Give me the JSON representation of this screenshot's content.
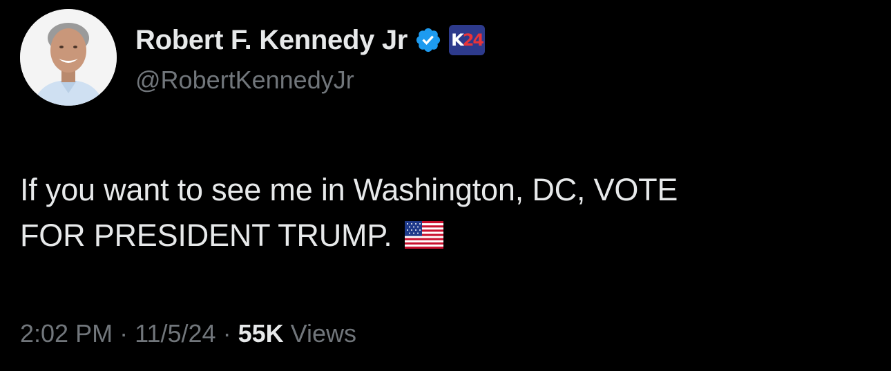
{
  "author": {
    "display_name": "Robert F. Kennedy Jr",
    "handle": "@RobertKennedyJr",
    "affiliate_badge": {
      "prefix": "K",
      "suffix": "24"
    }
  },
  "tweet": {
    "text_line1": "If you want to see me in Washington, DC, VOTE",
    "text_line2": "FOR PRESIDENT TRUMP.",
    "emoji": "us-flag-icon"
  },
  "meta": {
    "time": "2:02 PM",
    "date": "11/5/24",
    "views_count": "55K",
    "views_label": "Views",
    "separator": "·"
  },
  "colors": {
    "background": "#000000",
    "primary_text": "#e7e9ea",
    "secondary_text": "#71767b",
    "verified_blue": "#1d9bf0",
    "badge_navy": "#2d3a8c",
    "badge_red": "#e8343a"
  }
}
